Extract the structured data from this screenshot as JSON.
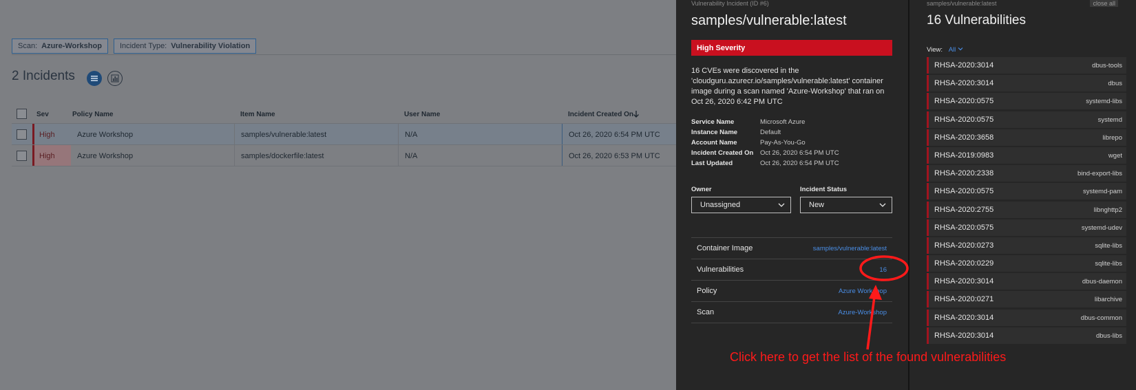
{
  "background_page": {
    "filters": [
      {
        "key": "Scan:",
        "value": "Azure-Workshop"
      },
      {
        "key": "Incident Type:",
        "value": "Vulnerability Violation"
      }
    ],
    "incident_count": "2 Incidents",
    "columns": [
      "Sev",
      "Policy Name",
      "Item Name",
      "User Name",
      "Incident Created On"
    ],
    "sort_icon": "arrow-down-icon",
    "rows": [
      {
        "sev": "High",
        "policy": "Azure Workshop",
        "item": "samples/vulnerable:latest",
        "user": "N/A",
        "created": "Oct 26, 2020 6:54 PM UTC"
      },
      {
        "sev": "High",
        "policy": "Azure Workshop",
        "item": "samples/dockerfile:latest",
        "user": "N/A",
        "created": "Oct 26, 2020 6:53 PM UTC"
      }
    ]
  },
  "incident": {
    "subtitle": "Vulnerability Incident (ID #6)",
    "title": "samples/vulnerable:latest",
    "severity": "High Severity",
    "description": "16 CVEs were discovered in the 'cloudguru.azurecr.io/samples/vulnerable:latest' container image during a scan named 'Azure-Workshop' that ran on Oct 26, 2020 6:42 PM UTC",
    "meta": [
      {
        "label": "Service Name",
        "value": "Microsoft Azure"
      },
      {
        "label": "Instance Name",
        "value": "Default"
      },
      {
        "label": "Account Name",
        "value": "Pay-As-You-Go"
      },
      {
        "label": "Incident Created On",
        "value": "Oct 26, 2020 6:54 PM UTC"
      },
      {
        "label": "Last Updated",
        "value": "Oct 26, 2020 6:54 PM UTC"
      }
    ],
    "owner": {
      "label": "Owner",
      "value": "Unassigned"
    },
    "status": {
      "label": "Incident Status",
      "value": "New"
    },
    "links": [
      {
        "label": "Container Image",
        "value": "samples/vulnerable:latest"
      },
      {
        "label": "Vulnerabilities",
        "value": "16"
      },
      {
        "label": "Policy",
        "value": "Azure Workshop"
      },
      {
        "label": "Scan",
        "value": "Azure-Workshop"
      }
    ]
  },
  "vulnerabilities": {
    "subtitle": "samples/vulnerable:latest",
    "close_all": "close all",
    "title": "16 Vulnerabilities",
    "view_label": "View:",
    "view_value": "All",
    "items": [
      {
        "id": "RHSA-2020:3014",
        "package": "dbus-tools"
      },
      {
        "id": "RHSA-2020:3014",
        "package": "dbus"
      },
      {
        "id": "RHSA-2020:0575",
        "package": "systemd-libs"
      },
      {
        "id": "RHSA-2020:0575",
        "package": "systemd"
      },
      {
        "id": "RHSA-2020:3658",
        "package": "librepo"
      },
      {
        "id": "RHSA-2019:0983",
        "package": "wget"
      },
      {
        "id": "RHSA-2020:2338",
        "package": "bind-export-libs"
      },
      {
        "id": "RHSA-2020:0575",
        "package": "systemd-pam"
      },
      {
        "id": "RHSA-2020:2755",
        "package": "libnghttp2"
      },
      {
        "id": "RHSA-2020:0575",
        "package": "systemd-udev"
      },
      {
        "id": "RHSA-2020:0273",
        "package": "sqlite-libs"
      },
      {
        "id": "RHSA-2020:0229",
        "package": "sqlite-libs"
      },
      {
        "id": "RHSA-2020:3014",
        "package": "dbus-daemon"
      },
      {
        "id": "RHSA-2020:0271",
        "package": "libarchive"
      },
      {
        "id": "RHSA-2020:3014",
        "package": "dbus-common"
      },
      {
        "id": "RHSA-2020:3014",
        "package": "dbus-libs"
      }
    ]
  },
  "annotation": {
    "text": "Click here to get the list of the found vulnerabilities",
    "color": "#ff1a1a"
  },
  "colors": {
    "severity_red": "#c9101f",
    "link_blue": "#4a8ee6",
    "panel_bg": "#262626"
  }
}
